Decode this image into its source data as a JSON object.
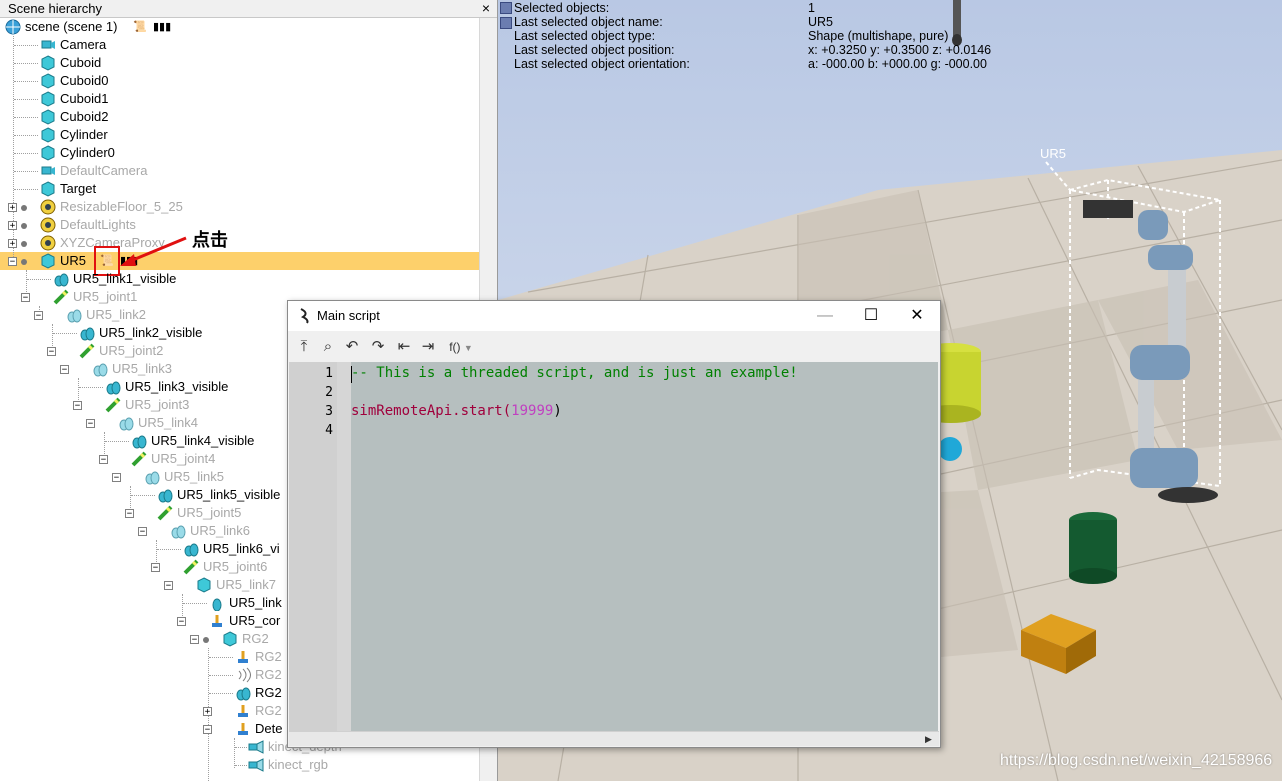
{
  "hierarchy": {
    "title": "Scene hierarchy",
    "close": "×",
    "items": [
      {
        "label": "scene (scene 1)"
      },
      {
        "label": "Camera"
      },
      {
        "label": "Cuboid"
      },
      {
        "label": "Cuboid0"
      },
      {
        "label": "Cuboid1"
      },
      {
        "label": "Cuboid2"
      },
      {
        "label": "Cylinder"
      },
      {
        "label": "Cylinder0"
      },
      {
        "label": "DefaultCamera"
      },
      {
        "label": "Target"
      },
      {
        "label": "ResizableFloor_5_25"
      },
      {
        "label": "DefaultLights"
      },
      {
        "label": "XYZCameraProxy"
      },
      {
        "label": "UR5"
      },
      {
        "label": "UR5_link1_visible"
      },
      {
        "label": "UR5_joint1"
      },
      {
        "label": "UR5_link2"
      },
      {
        "label": "UR5_link2_visible"
      },
      {
        "label": "UR5_joint2"
      },
      {
        "label": "UR5_link3"
      },
      {
        "label": "UR5_link3_visible"
      },
      {
        "label": "UR5_joint3"
      },
      {
        "label": "UR5_link4"
      },
      {
        "label": "UR5_link4_visible"
      },
      {
        "label": "UR5_joint4"
      },
      {
        "label": "UR5_link5"
      },
      {
        "label": "UR5_link5_visible"
      },
      {
        "label": "UR5_joint5"
      },
      {
        "label": "UR5_link6"
      },
      {
        "label": "UR5_link6_vi"
      },
      {
        "label": "UR5_joint6"
      },
      {
        "label": "UR5_link7"
      },
      {
        "label": "UR5_link"
      },
      {
        "label": "UR5_cor"
      },
      {
        "label": "RG2"
      },
      {
        "label": "RG2"
      },
      {
        "label": "RG2"
      },
      {
        "label": "RG2"
      },
      {
        "label": "RG2"
      },
      {
        "label": "Dete"
      },
      {
        "label": "kinect_depth"
      },
      {
        "label": "kinect_rgb"
      }
    ]
  },
  "info": {
    "rows": [
      {
        "label": "Selected objects:",
        "value": "1"
      },
      {
        "label": "Last selected object name:",
        "value": "UR5"
      },
      {
        "label": "Last selected object type:",
        "value": "Shape (multishape, pure)"
      },
      {
        "label": "Last selected object position:",
        "value": "x: +0.3250    y: +0.3500    z: +0.0146"
      },
      {
        "label": "Last selected object orientation:",
        "value": "a: -000.00    b: +000.00    g: -000.00"
      }
    ]
  },
  "viewport": {
    "object_label": "UR5"
  },
  "annotation": {
    "text": "点击"
  },
  "script_window": {
    "title": "Main script",
    "minimize": "—",
    "maximize": "☐",
    "close": "✕",
    "toolbar_func": "f()",
    "lines": [
      {
        "num": "1",
        "text": "-- This is a threaded script, and is just an example!"
      },
      {
        "num": "2",
        "text": ""
      },
      {
        "num": "3",
        "text": "simRemoteApi.start(",
        "arg": "19999",
        "tail": ")"
      },
      {
        "num": "4",
        "text": ""
      }
    ]
  },
  "watermark": "https://blog.csdn.net/weixin_42158966",
  "colors": {
    "highlight": "#fdd06b",
    "comment": "#008000",
    "code": "#a0003c",
    "number": "#c040c0"
  }
}
